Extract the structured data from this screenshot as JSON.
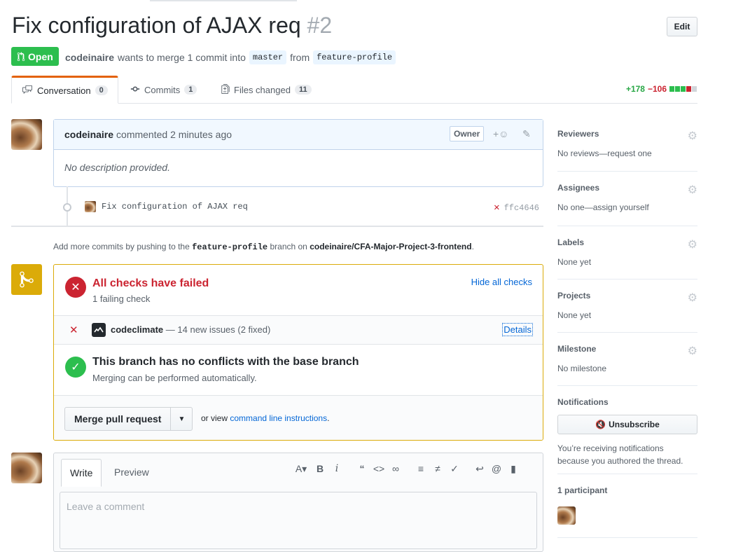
{
  "pr": {
    "title": "Fix configuration of AJAX req",
    "number": "#2",
    "edit_label": "Edit",
    "state": "Open",
    "author": "codeinaire",
    "meta_middle": "wants to merge 1 commit into",
    "base_branch": "master",
    "meta_from": "from",
    "head_branch": "feature-profile"
  },
  "tabs": [
    {
      "label": "Conversation",
      "count": "0"
    },
    {
      "label": "Commits",
      "count": "1"
    },
    {
      "label": "Files changed",
      "count": "11"
    }
  ],
  "diffstat": {
    "additions": "+178",
    "deletions": "−106"
  },
  "comment": {
    "author": "codeinaire",
    "action": "commented 2 minutes ago",
    "role_badge": "Owner",
    "body": "No description provided."
  },
  "commit": {
    "message": "Fix configuration of AJAX req",
    "sha": "ffc4646"
  },
  "push_note": {
    "prefix": "Add more commits by pushing to the",
    "branch": "feature-profile",
    "middle": "branch on",
    "repo": "codeinaire/CFA-Major-Project-3-frontend",
    "suffix": "."
  },
  "checks": {
    "heading": "All checks have failed",
    "subtext": "1 failing check",
    "hide_label": "Hide all checks",
    "check_name": "codeclimate",
    "check_desc": "— 14 new issues (2 fixed)",
    "details_label": "Details"
  },
  "conflicts": {
    "heading": "This branch has no conflicts with the base branch",
    "subtext": "Merging can be performed automatically."
  },
  "merge": {
    "button_label": "Merge pull request",
    "cli_prefix": "or view",
    "cli_link": "command line instructions",
    "cli_suffix": "."
  },
  "editor": {
    "write_tab": "Write",
    "preview_tab": "Preview",
    "placeholder": "Leave a comment"
  },
  "sidebar": {
    "reviewers": {
      "heading": "Reviewers",
      "value": "No reviews—request one"
    },
    "assignees": {
      "heading": "Assignees",
      "value": "No one—assign yourself"
    },
    "labels": {
      "heading": "Labels",
      "value": "None yet"
    },
    "projects": {
      "heading": "Projects",
      "value": "None yet"
    },
    "milestone": {
      "heading": "Milestone",
      "value": "No milestone"
    },
    "notifications": {
      "heading": "Notifications",
      "button": "Unsubscribe",
      "note_line1": "You’re receiving notifications",
      "note_line2": "because you authored the thread."
    },
    "participants": {
      "heading": "1 participant"
    }
  },
  "colors": {
    "open_green": "#2cbe4e",
    "fail_red": "#cb2431",
    "pending_yellow": "#dbab09",
    "link_blue": "#0366d6"
  }
}
